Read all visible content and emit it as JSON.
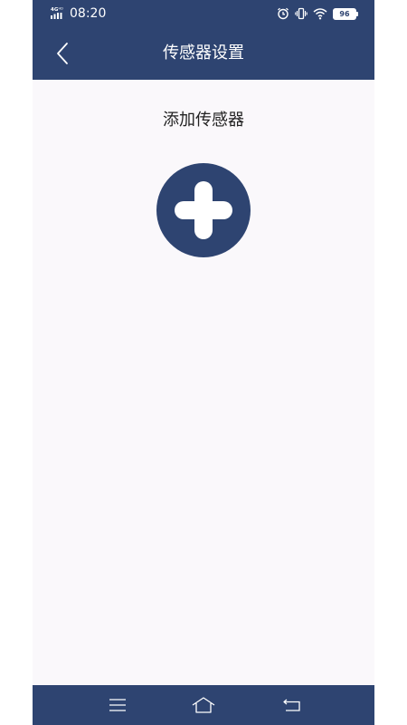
{
  "status_bar": {
    "network_label": "4G HD",
    "time": "08:20",
    "battery_level": "96",
    "icons": [
      "signal-icon",
      "alarm-icon",
      "vibrate-icon",
      "wifi-icon",
      "battery-icon"
    ]
  },
  "header": {
    "back_icon": "chevron-left-icon",
    "title": "传感器设置"
  },
  "main": {
    "section_label": "添加传感器",
    "add_icon": "plus-icon"
  },
  "nav_bar": {
    "icons": [
      "menu-icon",
      "home-icon",
      "back-arrow-icon"
    ]
  },
  "colors": {
    "primary": "#2e4471",
    "background": "#faf8fb",
    "text": "#222222",
    "on_primary": "#ffffff"
  }
}
